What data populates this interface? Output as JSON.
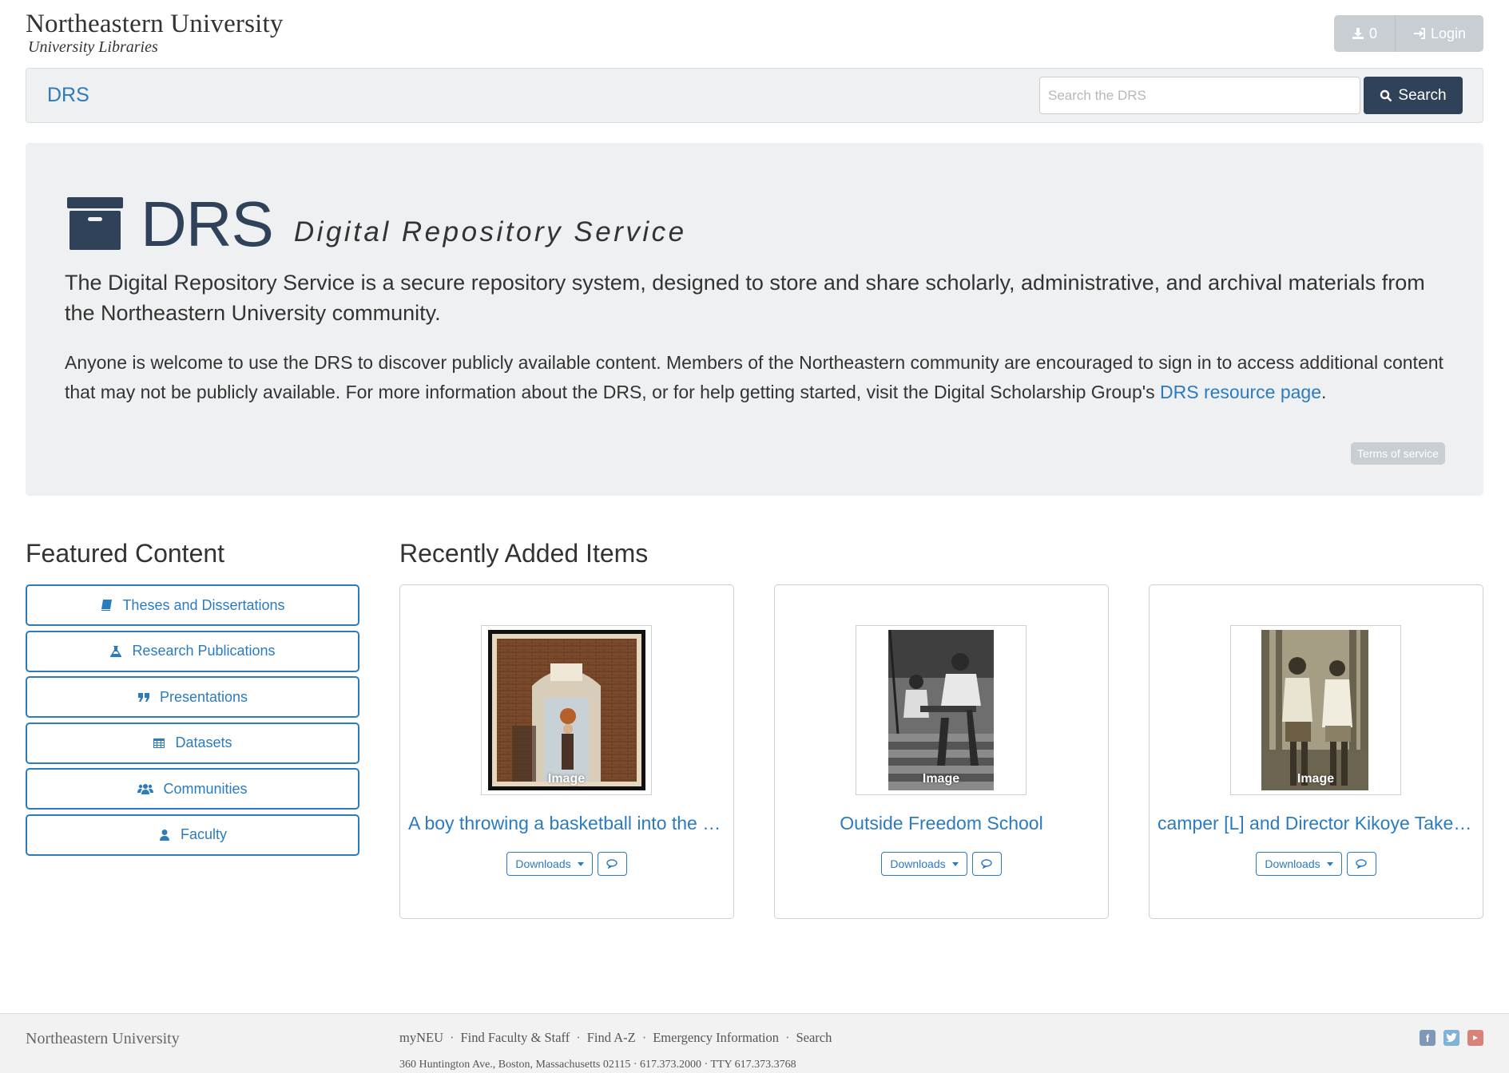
{
  "header": {
    "brand_title": "Northeastern University",
    "brand_subtitle": "University Libraries",
    "downloads_count": "0",
    "login_label": "Login"
  },
  "navbar": {
    "brand": "DRS",
    "search_placeholder": "Search the DRS",
    "search_button": "Search"
  },
  "jumbotron": {
    "title": "DRS",
    "tagline": "Digital Repository Service",
    "lead": "The Digital Repository Service is a secure repository system, designed to store and share scholarly, administrative, and archival materials from the Northeastern University community.",
    "text_before_link": "Anyone is welcome to use the DRS to discover publicly available content. Members of the Northeastern community are encouraged to sign in to access additional content that may not be publicly available. For more information about the DRS, or for help getting started, visit the Digital Scholarship Group's ",
    "link_text": "DRS resource page",
    "text_after_link": ".",
    "terms_label": "Terms of service"
  },
  "featured": {
    "title": "Featured Content",
    "items": [
      {
        "label": "Theses and Dissertations",
        "icon": "book-icon"
      },
      {
        "label": "Research Publications",
        "icon": "flask-icon"
      },
      {
        "label": "Presentations",
        "icon": "quote-icon"
      },
      {
        "label": "Datasets",
        "icon": "table-icon"
      },
      {
        "label": "Communities",
        "icon": "group-icon"
      },
      {
        "label": "Faculty",
        "icon": "user-icon"
      }
    ]
  },
  "recent": {
    "title": "Recently Added Items",
    "items": [
      {
        "title": "A boy throwing a basketball into the a…",
        "type_label": "Image",
        "downloads_label": "Downloads"
      },
      {
        "title": "Outside Freedom School",
        "type_label": "Image",
        "downloads_label": "Downloads"
      },
      {
        "title": "camper [L] and Director Kikoye Takeu…",
        "type_label": "Image",
        "downloads_label": "Downloads"
      }
    ]
  },
  "footer": {
    "brand": "Northeastern University",
    "links": [
      "myNEU",
      "Find Faculty & Staff",
      "Find A-Z",
      "Emergency Information",
      "Search"
    ],
    "address": "360 Huntington Ave., Boston, Massachusetts 02115 · 617.373.2000 · TTY 617.373.3768",
    "social": [
      "facebook-icon",
      "twitter-icon",
      "youtube-icon"
    ]
  },
  "colors": {
    "accent": "#2b7bbf",
    "dark": "#2f4259",
    "panel": "#eef0f2"
  }
}
